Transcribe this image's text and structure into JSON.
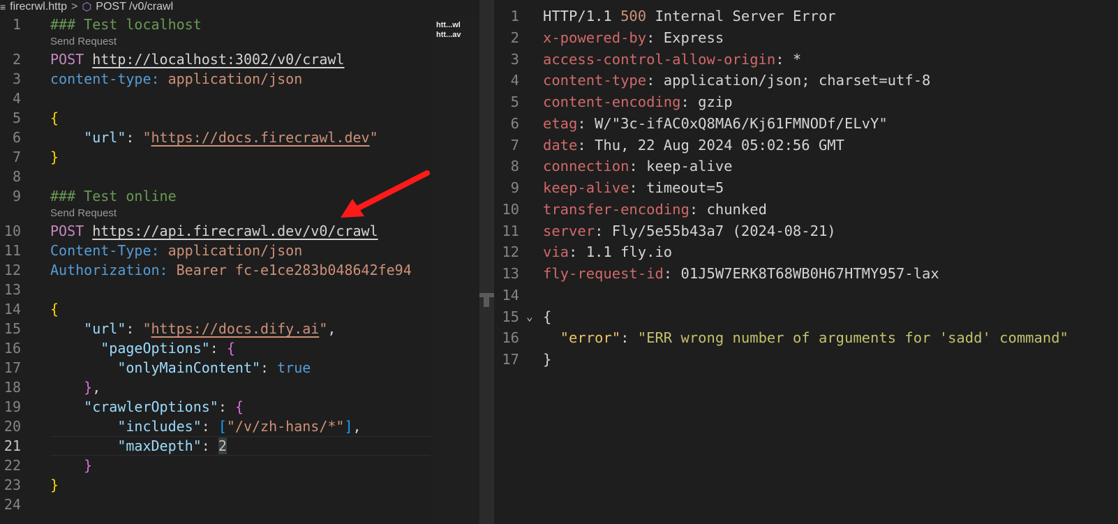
{
  "breadcrumb": {
    "file": "firecrwl.http",
    "separator": ">",
    "request": "POST /v0/crawl"
  },
  "codelens": "Send Request",
  "minimap": [
    "htt...wl",
    "htt...av"
  ],
  "request_lines": [
    {
      "n": "1",
      "t": [
        [
          "### Test localhost",
          "comment"
        ]
      ]
    },
    {
      "lens": true
    },
    {
      "n": "2",
      "t": [
        [
          "POST",
          "method"
        ],
        [
          " ",
          "plain"
        ],
        [
          "http://localhost:3002/v0/crawl",
          "url"
        ]
      ]
    },
    {
      "n": "3",
      "t": [
        [
          "content-type:",
          "hkey"
        ],
        [
          " application/json",
          "hval"
        ]
      ]
    },
    {
      "n": "4",
      "t": []
    },
    {
      "n": "5",
      "t": [
        [
          "{",
          "b1"
        ]
      ]
    },
    {
      "n": "6",
      "t": [
        [
          "    \"url\"",
          "key"
        ],
        [
          ": ",
          "plain"
        ],
        [
          "\"",
          "str"
        ],
        [
          "https://docs.firecrawl.dev",
          "link"
        ],
        [
          "\"",
          "str"
        ]
      ]
    },
    {
      "n": "7",
      "t": [
        [
          "}",
          "b1"
        ]
      ]
    },
    {
      "n": "8",
      "t": []
    },
    {
      "n": "9",
      "t": [
        [
          "### Test online",
          "comment"
        ]
      ]
    },
    {
      "lens": true
    },
    {
      "n": "10",
      "t": [
        [
          "POST",
          "method"
        ],
        [
          " ",
          "plain"
        ],
        [
          "https://api.firecrawl.dev/v0/crawl",
          "url"
        ]
      ]
    },
    {
      "n": "11",
      "t": [
        [
          "Content-Type:",
          "hkey"
        ],
        [
          " application/json",
          "hval"
        ]
      ]
    },
    {
      "n": "12",
      "t": [
        [
          "Authorization:",
          "hkey"
        ],
        [
          " Bearer fc-e1ce283b048642fe94",
          "hval"
        ]
      ]
    },
    {
      "n": "13",
      "t": []
    },
    {
      "n": "14",
      "t": [
        [
          "{",
          "b1"
        ]
      ]
    },
    {
      "n": "15",
      "t": [
        [
          "    \"url\"",
          "key"
        ],
        [
          ": ",
          "plain"
        ],
        [
          "\"",
          "str"
        ],
        [
          "https://docs.dify.ai",
          "link"
        ],
        [
          "\"",
          "str"
        ],
        [
          ",",
          "plain"
        ]
      ]
    },
    {
      "n": "16",
      "t": [
        [
          "      \"pageOptions\"",
          "key"
        ],
        [
          ": ",
          "plain"
        ],
        [
          "{",
          "b2"
        ]
      ]
    },
    {
      "n": "17",
      "t": [
        [
          "        \"onlyMainContent\"",
          "key"
        ],
        [
          ": ",
          "plain"
        ],
        [
          "true",
          "bool"
        ]
      ]
    },
    {
      "n": "18",
      "t": [
        [
          "    ",
          "plain"
        ],
        [
          "}",
          "b2"
        ],
        [
          ",",
          "plain"
        ]
      ]
    },
    {
      "n": "19",
      "t": [
        [
          "    \"crawlerOptions\"",
          "key"
        ],
        [
          ": ",
          "plain"
        ],
        [
          "{",
          "b2"
        ]
      ]
    },
    {
      "n": "20",
      "t": [
        [
          "        \"includes\"",
          "key"
        ],
        [
          ": ",
          "plain"
        ],
        [
          "[",
          "b3"
        ],
        [
          "\"/v/zh-hans/*\"",
          "str"
        ],
        [
          "]",
          "b3"
        ],
        [
          ",",
          "plain"
        ]
      ]
    },
    {
      "n": "21",
      "cur": true,
      "t": [
        [
          "        \"maxDepth\"",
          "key"
        ],
        [
          ": ",
          "plain"
        ],
        [
          "2",
          "num"
        ]
      ]
    },
    {
      "n": "22",
      "t": [
        [
          "    ",
          "plain"
        ],
        [
          "}",
          "b2"
        ]
      ]
    },
    {
      "n": "23",
      "t": [
        [
          "}",
          "b1"
        ]
      ]
    },
    {
      "n": "24",
      "t": []
    }
  ],
  "response_lines": [
    {
      "n": "1",
      "t": [
        [
          "HTTP/1.1 ",
          "plain"
        ],
        [
          "500",
          "status"
        ],
        [
          " Internal Server Error",
          "plain"
        ]
      ]
    },
    {
      "n": "2",
      "t": [
        [
          "x-powered-by",
          "rkey"
        ],
        [
          ": Express",
          "plain"
        ]
      ]
    },
    {
      "n": "3",
      "t": [
        [
          "access-control-allow-origin",
          "rkey"
        ],
        [
          ": *",
          "plain"
        ]
      ]
    },
    {
      "n": "4",
      "t": [
        [
          "content-type",
          "rkey"
        ],
        [
          ": application/json; charset=utf-8",
          "plain"
        ]
      ]
    },
    {
      "n": "5",
      "t": [
        [
          "content-encoding",
          "rkey"
        ],
        [
          ": gzip",
          "plain"
        ]
      ]
    },
    {
      "n": "6",
      "t": [
        [
          "etag",
          "rkey"
        ],
        [
          ": W/\"3c-ifAC0xQ8MA6/Kj61FMNODf/ELvY\"",
          "plain"
        ]
      ]
    },
    {
      "n": "7",
      "t": [
        [
          "date",
          "rkey"
        ],
        [
          ": Thu, 22 Aug 2024 05:02:56 GMT",
          "plain"
        ]
      ]
    },
    {
      "n": "8",
      "t": [
        [
          "connection",
          "rkey"
        ],
        [
          ": keep-alive",
          "plain"
        ]
      ]
    },
    {
      "n": "9",
      "t": [
        [
          "keep-alive",
          "rkey"
        ],
        [
          ": timeout=5",
          "plain"
        ]
      ]
    },
    {
      "n": "10",
      "t": [
        [
          "transfer-encoding",
          "rkey"
        ],
        [
          ": chunked",
          "plain"
        ]
      ]
    },
    {
      "n": "11",
      "t": [
        [
          "server",
          "rkey"
        ],
        [
          ": Fly/5e55b43a7 (2024-08-21)",
          "plain"
        ]
      ]
    },
    {
      "n": "12",
      "t": [
        [
          "via",
          "rkey"
        ],
        [
          ": 1.1 fly.io",
          "plain"
        ]
      ]
    },
    {
      "n": "13",
      "t": [
        [
          "fly-request-id",
          "rkey"
        ],
        [
          ": 01J5W7ERK8T68WB0H67HTMY957-lax",
          "plain"
        ]
      ]
    },
    {
      "n": "14",
      "t": []
    },
    {
      "n": "15",
      "fold": true,
      "t": [
        [
          "{",
          "plain"
        ]
      ]
    },
    {
      "n": "16",
      "t": [
        [
          "  \"error\"",
          "jkey"
        ],
        [
          ": ",
          "plain"
        ],
        [
          "\"ERR wrong number of arguments for 'sadd' command\"",
          "jstr"
        ]
      ]
    },
    {
      "n": "17",
      "t": [
        [
          "}",
          "plain"
        ]
      ]
    }
  ],
  "colors": {
    "background": "#1e1e1e",
    "annotation_arrow": "#ff1a1a"
  }
}
